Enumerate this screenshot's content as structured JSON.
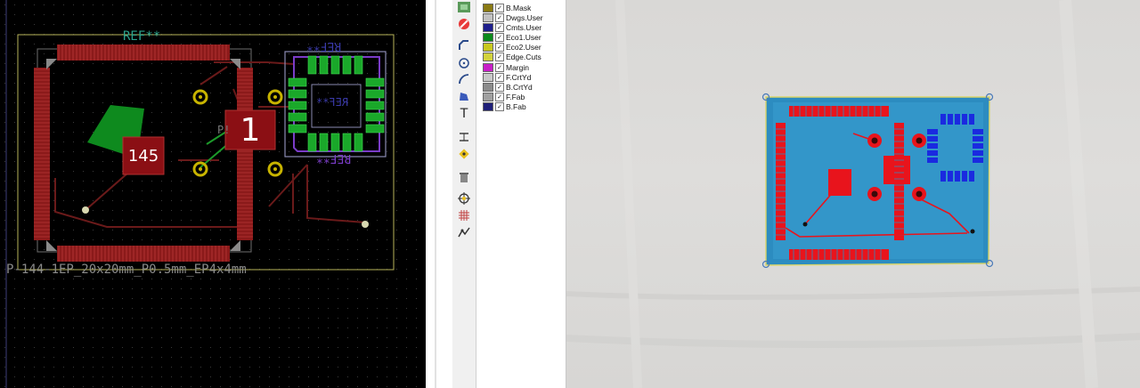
{
  "pcb_editor": {
    "ref_top": "REF**",
    "ref_mirrored_top": "REF**",
    "ref_mirrored_mid": "REF**",
    "ref_mirrored_bottom": "REF**",
    "footprint_value": "P-144-1EP_20x20mm_P0.5mm_EP4x4mm",
    "pad_145_label": "145",
    "pad_1_label": "1",
    "partial_label": "P!"
  },
  "layers": [
    {
      "name": "B.Mask",
      "color": "#8a7a14"
    },
    {
      "name": "Dwgs.User",
      "color": "#c2c2c2"
    },
    {
      "name": "Cmts.User",
      "color": "#1e1e8c"
    },
    {
      "name": "Eco1.User",
      "color": "#0c8a1c"
    },
    {
      "name": "Eco2.User",
      "color": "#c8c81e"
    },
    {
      "name": "Edge.Cuts",
      "color": "#d2d23c"
    },
    {
      "name": "Margin",
      "color": "#c81ec8"
    },
    {
      "name": "F.CrtYd",
      "color": "#c8c8c8"
    },
    {
      "name": "B.CrtYd",
      "color": "#8c8c8c"
    },
    {
      "name": "F.Fab",
      "color": "#a0a0a0"
    },
    {
      "name": "B.Fab",
      "color": "#1e1e78"
    }
  ],
  "toolbar_icons": [
    "grid-icon",
    "no-icon",
    "route-track-icon",
    "circle-icon",
    "arc-icon",
    "polygon-icon",
    "text-icon",
    "dimension-icon",
    "anchor-icon",
    "delete-icon",
    "origin-icon",
    "grid-origin-icon",
    "measure-icon"
  ]
}
